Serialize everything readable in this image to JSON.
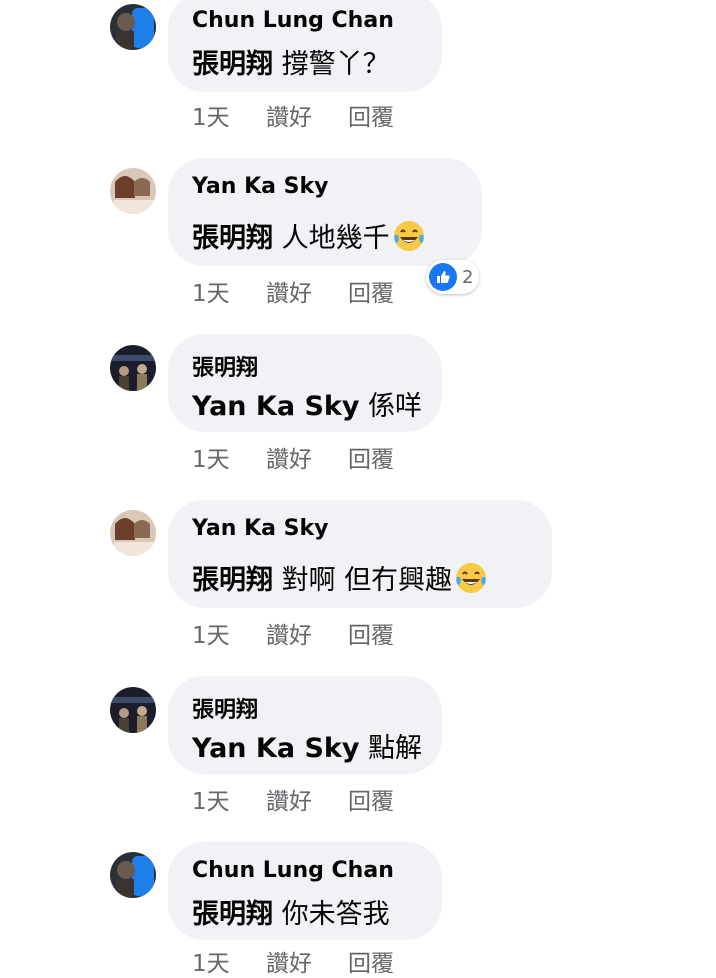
{
  "colors": {
    "bubble_bg": "#f0f2f5",
    "meta_text": "#65676b",
    "like_blue": "#1877f2"
  },
  "comments": [
    {
      "author": "Chun Lung Chan",
      "mention": "張明翔",
      "text": "撐警丫？",
      "emoji": "",
      "time": "1天",
      "like_label": "讚好",
      "reply_label": "回覆",
      "avatar": "avatar-chun-lung-chan"
    },
    {
      "author": "Yan Ka Sky",
      "mention": "張明翔",
      "text": "人地幾千",
      "emoji": "tears-of-joy-emoji",
      "time": "1天",
      "like_label": "讚好",
      "reply_label": "回覆",
      "reaction_count": "2",
      "avatar": "avatar-yan-ka-sky"
    },
    {
      "author": "張明翔",
      "mention": "Yan Ka Sky",
      "text": "係咩",
      "emoji": "",
      "time": "1天",
      "like_label": "讚好",
      "reply_label": "回覆",
      "avatar": "avatar-zhang-ming-xiang"
    },
    {
      "author": "Yan Ka Sky",
      "mention": "張明翔",
      "text": "對啊 但冇興趣",
      "emoji": "tears-of-joy-emoji",
      "time": "1天",
      "like_label": "讚好",
      "reply_label": "回覆",
      "avatar": "avatar-yan-ka-sky"
    },
    {
      "author": "張明翔",
      "mention": "Yan Ka Sky",
      "text": "點解",
      "emoji": "",
      "time": "1天",
      "like_label": "讚好",
      "reply_label": "回覆",
      "avatar": "avatar-zhang-ming-xiang"
    },
    {
      "author": "Chun Lung Chan",
      "mention": "張明翔",
      "text": "你未答我",
      "emoji": "",
      "time": "1天",
      "like_label": "讚好",
      "reply_label": "回覆",
      "avatar": "avatar-chun-lung-chan"
    }
  ]
}
